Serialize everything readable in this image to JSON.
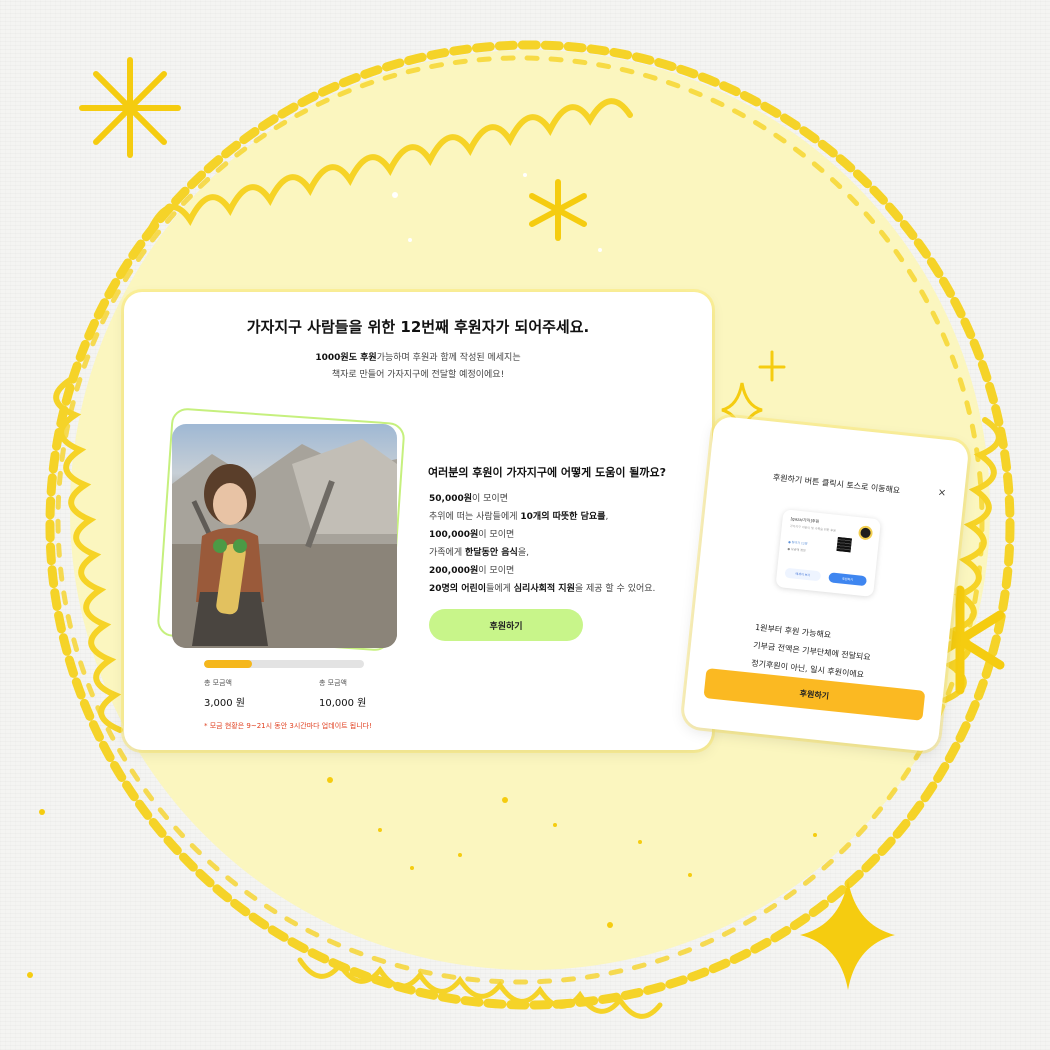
{
  "main": {
    "title": "가자지구 사람들을 위한 12번째 후원자가 되어주세요.",
    "subtitle_bold": "1000원도 후원",
    "subtitle_rest": "가능하며 후원과 함께 작성된 메세지는",
    "subtitle_line2": "책자로 만들어 가자지구에 전달할 예정이에요!",
    "help_title": "여러분의 후원이 가자지구에 어떻게 도움이 될까요?",
    "lines": {
      "a_bold": "50,000원",
      "a_rest": "이 모이면",
      "b_pre": "추위에 떠는 사람들에게 ",
      "b_bold": "10개의 따뜻한 담요를",
      "b_post": ",",
      "c_bold": "100,000원",
      "c_rest": "이 모이면",
      "d_pre": "가족에게 ",
      "d_bold": "한달동안 음식",
      "d_post": "을,",
      "e_bold": "200,000원",
      "e_rest": "이 모이면",
      "f_bold1": "20명의 어린이",
      "f_mid": "들에게 ",
      "f_bold2": "심리사회적 지원",
      "f_post": "을 제공 할 수 있어요."
    },
    "donate_button": "후원하기",
    "progress_percent": 30,
    "stat_left_label": "총 모금액",
    "stat_left_value": "3,000 원",
    "stat_right_label": "총 모금액",
    "stat_right_value": "10,000 원",
    "note": "* 모금 현황은 9~21시 동안 3시간마다 업데이트 됩니다!"
  },
  "side": {
    "title": "후원하기 버튼 클릭시 토스로 이동해요",
    "close": "×",
    "mini_name": "[gaza/가자]후원",
    "mini_sub": "가자지구 어린이 및 가족을 위한 후원",
    "mini_row1": "● 참여자 12명",
    "mini_row2": "● 모금액 정보",
    "mini_btn1": "메세지 보기",
    "mini_btn2": "후원하기",
    "line1": "1원부터 후원 가능해요",
    "line2": "기부금 전액은 기부단체에 전달되요",
    "line3": "정기후원이 아닌, 일시 후원이에요",
    "button": "후원하기"
  },
  "colors": {
    "circle": "#fbf6bf",
    "scribble": "#f6d21e",
    "accent_green": "#c8f58a",
    "accent_orange": "#fbb922",
    "note_red": "#e04020"
  }
}
